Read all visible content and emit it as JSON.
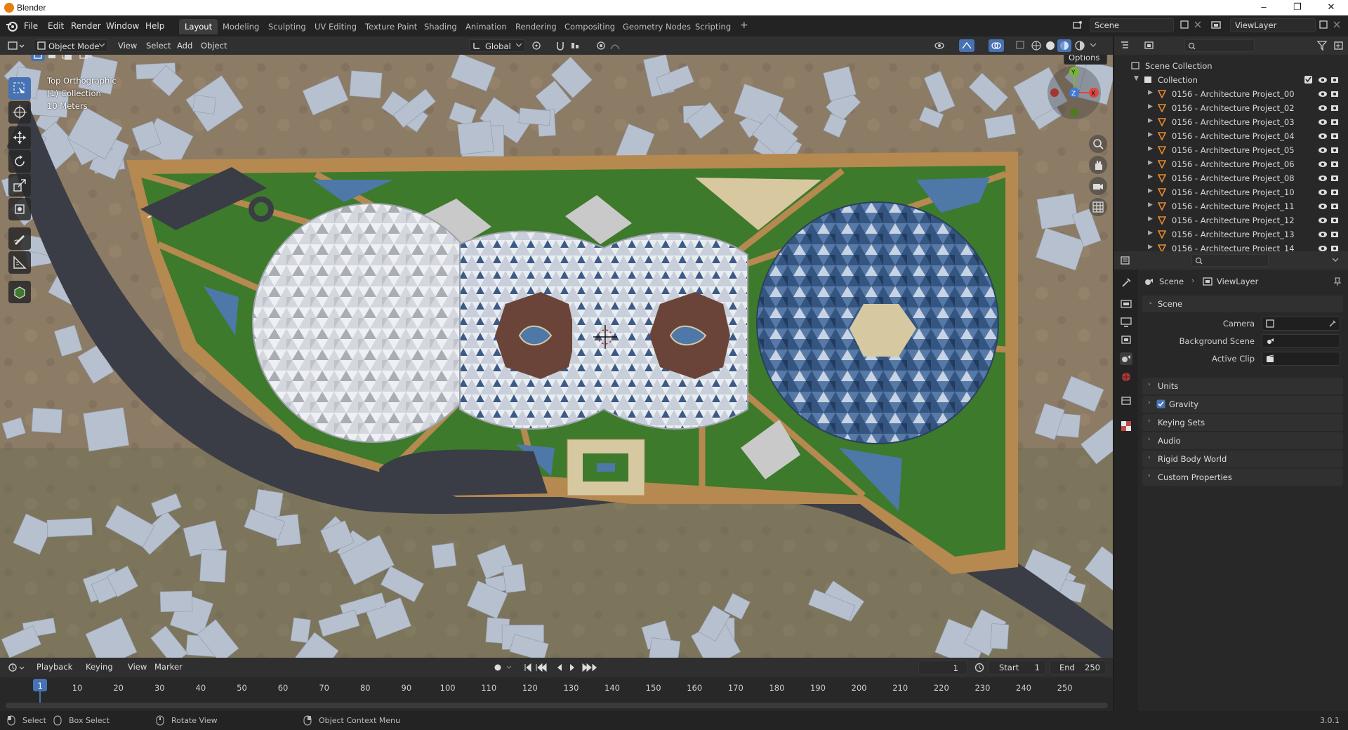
{
  "window": {
    "title": "Blender",
    "controls": [
      "–",
      "❐",
      "✕"
    ]
  },
  "menu": [
    "File",
    "Edit",
    "Render",
    "Window",
    "Help"
  ],
  "workspaces": [
    {
      "label": "Layout",
      "active": true
    },
    {
      "label": "Modeling"
    },
    {
      "label": "Sculpting"
    },
    {
      "label": "UV Editing"
    },
    {
      "label": "Texture Paint"
    },
    {
      "label": "Shading"
    },
    {
      "label": "Animation"
    },
    {
      "label": "Rendering"
    },
    {
      "label": "Compositing"
    },
    {
      "label": "Geometry Nodes"
    },
    {
      "label": "Scripting"
    },
    {
      "label": "+"
    }
  ],
  "scene_selector": {
    "value": "Scene"
  },
  "viewlayer_selector": {
    "value": "ViewLayer"
  },
  "viewport_header": {
    "mode": "Object Mode",
    "menus": [
      "View",
      "Select",
      "Add",
      "Object"
    ],
    "transform_orientation": "Global",
    "options_label": "Options"
  },
  "viewport_overlay": {
    "view_name": "Top Orthographic",
    "collection": "(1) Collection",
    "scale": "10 Meters"
  },
  "gizmo": {
    "x": "X",
    "y": "Y",
    "z": "Z"
  },
  "outliner": {
    "root": "Scene Collection",
    "collection": "Collection",
    "items": [
      "0156 - Architecture Project_00",
      "0156 - Architecture Project_02",
      "0156 - Architecture Project_03",
      "0156 - Architecture Project_04",
      "0156 - Architecture Project_05",
      "0156 - Architecture Project_06",
      "0156 - Architecture Project_08",
      "0156 - Architecture Project_10",
      "0156 - Architecture Project_11",
      "0156 - Architecture Project_12",
      "0156 - Architecture Project_13",
      "0156 - Architecture Project_14"
    ]
  },
  "properties": {
    "breadcrumb": [
      "Scene",
      "ViewLayer"
    ],
    "panel_title": "Scene",
    "fields": [
      {
        "label": "Camera"
      },
      {
        "label": "Background Scene"
      },
      {
        "label": "Active Clip"
      }
    ],
    "subpanels": [
      {
        "label": "Units"
      },
      {
        "label": "Gravity",
        "checked": true
      },
      {
        "label": "Keying Sets"
      },
      {
        "label": "Audio"
      },
      {
        "label": "Rigid Body World"
      },
      {
        "label": "Custom Properties"
      }
    ]
  },
  "timeline": {
    "menus": [
      "Playback",
      "Keying",
      "View",
      "Marker"
    ],
    "current_frame": "1",
    "start_label": "Start",
    "start": "1",
    "end_label": "End",
    "end": "250",
    "ruler": [
      "1",
      "10",
      "20",
      "30",
      "40",
      "50",
      "60",
      "70",
      "80",
      "90",
      "100",
      "110",
      "120",
      "130",
      "140",
      "150",
      "160",
      "170",
      "180",
      "190",
      "200",
      "210",
      "220",
      "230",
      "240",
      "250"
    ]
  },
  "statusbar": {
    "select": "Select",
    "box_select": "Box Select",
    "rotate_view": "Rotate View",
    "context_menu": "Object Context Menu",
    "version": "3.0.1"
  },
  "colors": {
    "accent": "#4772b3",
    "orange": "#e87d0d",
    "grass": "#3f7a2a",
    "road": "#3a3d45",
    "dome_white": "#d8dadf",
    "dome_blue": "#3e5f8d",
    "building": "#b4bdcc"
  }
}
